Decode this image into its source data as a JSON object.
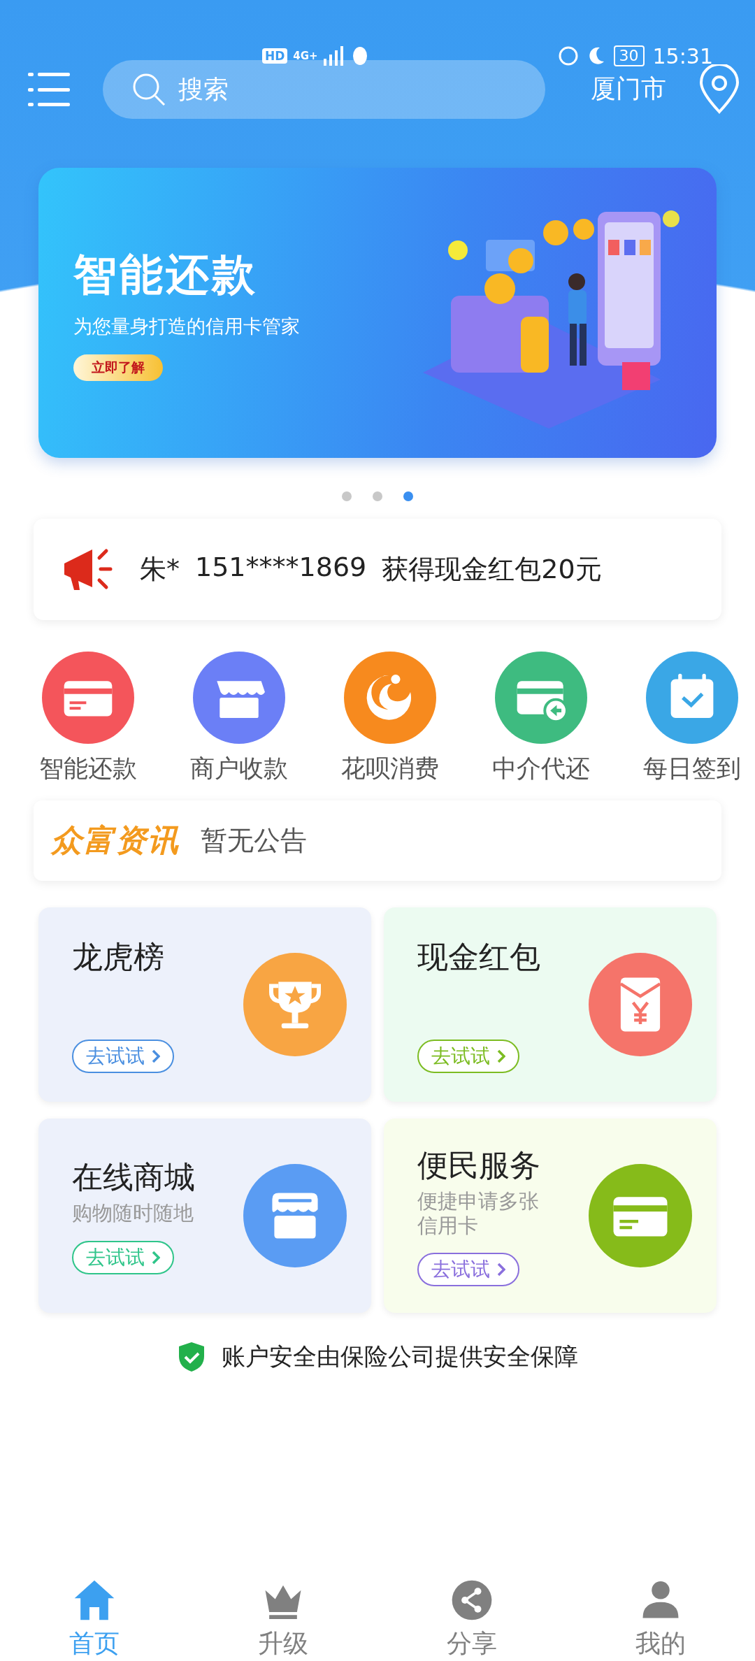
{
  "status_bar": {
    "network_badge": "HD",
    "network": "4G+",
    "battery": "30",
    "time": "15:31"
  },
  "header": {
    "search": {
      "placeholder": "搜索"
    },
    "city": "厦门市"
  },
  "banner": {
    "title": "智能还款",
    "subtitle": "为您量身打造的信用卡管家",
    "button": "立即了解"
  },
  "carousel_dots": [
    {
      "selected": false
    },
    {
      "selected": false
    },
    {
      "selected": true
    }
  ],
  "ticker": {
    "name": "朱*",
    "phone": "151****1869",
    "message": "获得现金红包20元"
  },
  "shortcuts": [
    {
      "label": "智能还款",
      "kind": "card",
      "color": "#f4555b"
    },
    {
      "label": "商户收款",
      "kind": "store",
      "color": "#6b7ff6"
    },
    {
      "label": "花呗消费",
      "kind": "swirl",
      "color": "#f78a1e"
    },
    {
      "label": "中介代还",
      "kind": "card-return",
      "color": "#3ebb80"
    },
    {
      "label": "每日签到",
      "kind": "calendar",
      "color": "#3aa7e6"
    }
  ],
  "news": {
    "brand": "众富资讯",
    "text": "暂无公告"
  },
  "cards": [
    {
      "title": "龙虎榜",
      "kind": "trophy",
      "color": "#f8a543",
      "button": "去试试"
    },
    {
      "title": "现金红包",
      "kind": "envelope",
      "color": "#f5746a",
      "button": "去试试"
    },
    {
      "title": "在线商城",
      "subtitle": "购物随时随地",
      "kind": "shop",
      "color": "#5a9cf3",
      "button": "去试试"
    },
    {
      "title": "便民服务",
      "subtitle": "便捷申请多张信用卡",
      "kind": "card",
      "color": "#86bb1a",
      "button": "去试试"
    }
  ],
  "security_note": "账户安全由保险公司提供安全保障",
  "nav": [
    {
      "label": "首页",
      "kind": "home",
      "selected": true
    },
    {
      "label": "升级",
      "kind": "crown",
      "selected": false
    },
    {
      "label": "分享",
      "kind": "share",
      "selected": false
    },
    {
      "label": "我的",
      "kind": "person",
      "selected": false
    }
  ]
}
